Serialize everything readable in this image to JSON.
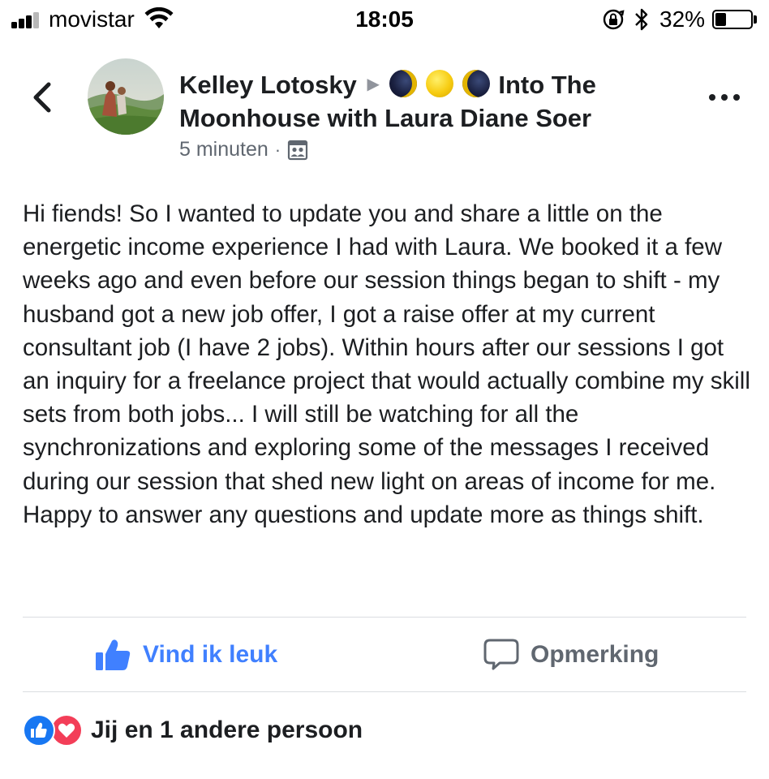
{
  "status_bar": {
    "carrier": "movistar",
    "time": "18:05",
    "battery_percent": "32%",
    "battery_level": 0.32,
    "icons": [
      "signal-icon",
      "wifi-icon",
      "rotation-lock-icon",
      "bluetooth-icon",
      "battery-icon"
    ]
  },
  "header": {
    "author": "Kelley Lotosky",
    "group_emoji": [
      "new-moon",
      "full-moon",
      "waning-moon"
    ],
    "group_name_part1": "Into The",
    "group_name_part2": "Moonhouse with Laura Diane Soer",
    "timestamp": "5 minuten",
    "separator": "·",
    "audience_icon": "group-audience-icon"
  },
  "post": {
    "text": "Hi fiends! So I wanted to update you and share a little on the energetic income experience I had with Laura. We booked it a few weeks ago and even before our session things began to shift - my husband got a new job offer, I got a raise offer at my current consultant job (I have 2 jobs). Within hours after our sessions I got an inquiry for a freelance project that would actually combine my skill sets from both jobs... I will still be watching for all the synchronizations and exploring some of the messages I received during our session that shed new light on areas of income for me. Happy to answer any questions and update more as things shift."
  },
  "actions": {
    "like_label": "Vind ik leuk",
    "comment_label": "Opmerking"
  },
  "reactions": {
    "summary": "Jij en 1 andere persoon",
    "types": [
      "like",
      "love"
    ]
  },
  "colors": {
    "like_blue": "#4080ff",
    "facebook_blue": "#1877f2",
    "love_red": "#f33e58",
    "secondary_text": "#606770"
  }
}
